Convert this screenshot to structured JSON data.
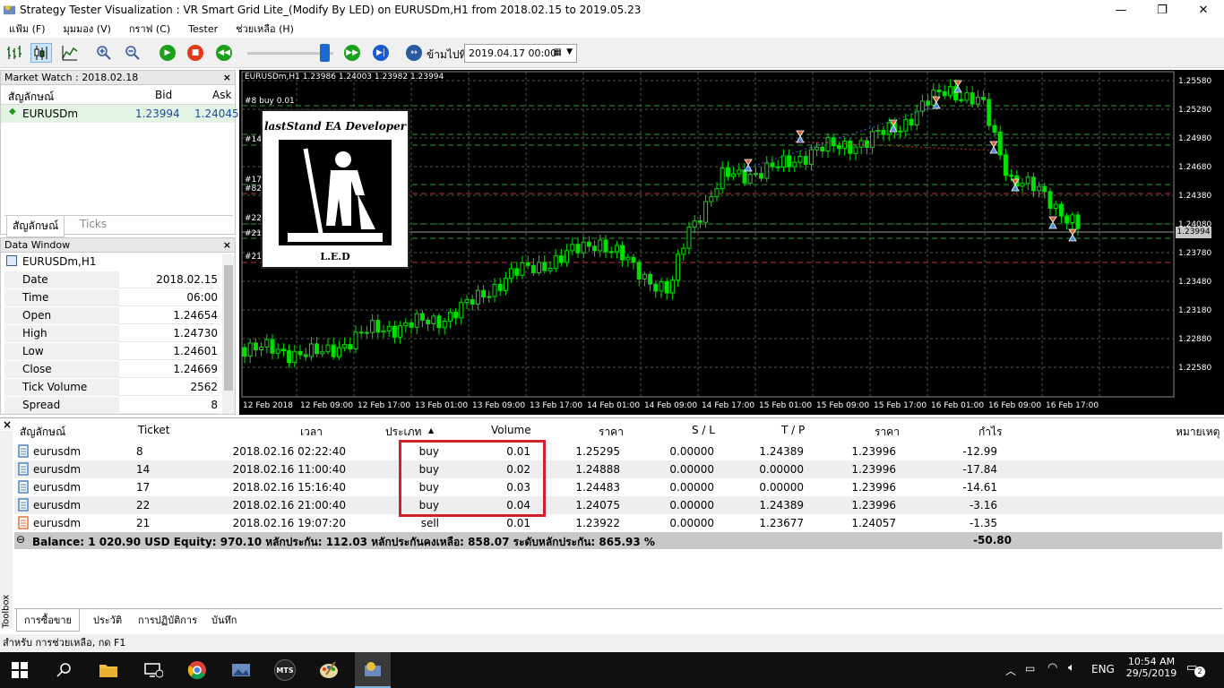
{
  "window": {
    "title": "Strategy Tester Visualization : VR Smart Grid Lite_(Modify By LED) on EURUSDm,H1 from 2018.02.15 to 2019.05.23"
  },
  "menu": [
    "แฟ้ม (F)",
    "มุมมอง (V)",
    "กราฟ (C)",
    "Tester",
    "ช่วยเหลือ (H)"
  ],
  "toolbar": {
    "goto_label": "ข้ามไปที่",
    "goto_date": "2019.04.17 00:00"
  },
  "market_watch": {
    "title": "Market Watch : 2018.02.18",
    "headers": {
      "symbol": "สัญลักษณ์",
      "bid": "Bid",
      "ask": "Ask"
    },
    "rows": [
      {
        "symbol": "EURUSDm",
        "bid": "1.23994",
        "ask": "1.24045"
      }
    ],
    "tabs": [
      "สัญลักษณ์",
      "Ticks"
    ]
  },
  "data_window": {
    "title": "Data Window",
    "symbol": "EURUSDm,H1",
    "rows": [
      {
        "key": "Date",
        "value": "2018.02.15"
      },
      {
        "key": "Time",
        "value": "06:00"
      },
      {
        "key": "Open",
        "value": "1.24654"
      },
      {
        "key": "High",
        "value": "1.24730"
      },
      {
        "key": "Low",
        "value": "1.24601"
      },
      {
        "key": "Close",
        "value": "1.24669"
      },
      {
        "key": "Tick Volume",
        "value": "2562"
      },
      {
        "key": "Spread",
        "value": "8"
      }
    ]
  },
  "chart": {
    "header": "EURUSDm,H1  1.23986 1.24003 1.23982 1.23994",
    "buy_label": "#8 buy 0.01",
    "order_tags": [
      "#14",
      "#17",
      "#82",
      "#22",
      "#21",
      "#21"
    ],
    "logo_top": "lastStand EA Developer",
    "logo_bottom": "L.E.D",
    "current_price": "1.23994",
    "price_labels": [
      "1.25580",
      "1.25280",
      "1.24980",
      "1.24680",
      "1.24380",
      "1.24080",
      "1.23780",
      "1.23480",
      "1.23180",
      "1.22880",
      "1.22580"
    ],
    "time_labels": [
      "12 Feb 2018",
      "12 Feb 09:00",
      "12 Feb 17:00",
      "13 Feb 01:00",
      "13 Feb 09:00",
      "13 Feb 17:00",
      "14 Feb 01:00",
      "14 Feb 09:00",
      "14 Feb 17:00",
      "15 Feb 01:00",
      "15 Feb 09:00",
      "15 Feb 17:00",
      "16 Feb 01:00",
      "16 Feb 09:00",
      "16 Feb 17:00"
    ]
  },
  "terminal": {
    "headers": {
      "symbol": "สัญลักษณ์",
      "ticket": "Ticket",
      "time": "เวลา",
      "type": "ประเภท",
      "volume": "Volume",
      "price": "ราคา",
      "sl": "S / L",
      "tp": "T / P",
      "price2": "ราคา",
      "profit": "กำไร",
      "comment": "หมายเหตุ"
    },
    "rows": [
      {
        "symbol": "eurusdm",
        "ticket": "8",
        "time": "2018.02.16 02:22:40",
        "type": "buy",
        "volume": "0.01",
        "price": "1.25295",
        "sl": "0.00000",
        "tp": "1.24389",
        "price2": "1.23996",
        "profit": "-12.99",
        "kind": "buy"
      },
      {
        "symbol": "eurusdm",
        "ticket": "14",
        "time": "2018.02.16 11:00:40",
        "type": "buy",
        "volume": "0.02",
        "price": "1.24888",
        "sl": "0.00000",
        "tp": "0.00000",
        "price2": "1.23996",
        "profit": "-17.84",
        "kind": "buy"
      },
      {
        "symbol": "eurusdm",
        "ticket": "17",
        "time": "2018.02.16 15:16:40",
        "type": "buy",
        "volume": "0.03",
        "price": "1.24483",
        "sl": "0.00000",
        "tp": "0.00000",
        "price2": "1.23996",
        "profit": "-14.61",
        "kind": "buy"
      },
      {
        "symbol": "eurusdm",
        "ticket": "22",
        "time": "2018.02.16 21:00:40",
        "type": "buy",
        "volume": "0.04",
        "price": "1.24075",
        "sl": "0.00000",
        "tp": "1.24389",
        "price2": "1.23996",
        "profit": "-3.16",
        "kind": "buy"
      },
      {
        "symbol": "eurusdm",
        "ticket": "21",
        "time": "2018.02.16 19:07:20",
        "type": "sell",
        "volume": "0.01",
        "price": "1.23922",
        "sl": "0.00000",
        "tp": "1.23677",
        "price2": "1.24057",
        "profit": "-1.35",
        "kind": "sell"
      }
    ],
    "balance_line": "Balance: 1 020.90 USD  Equity: 970.10  หลักประกัน: 112.03  หลักประกันคงเหลือ: 858.07  ระดับหลักประกัน: 865.93 %",
    "balance_total": "-50.80",
    "tabs": [
      "การซื้อขาย",
      "ประวัติ",
      "การปฏิบัติการ",
      "บันทึก"
    ],
    "toolbox_label": "Toolbox"
  },
  "status": {
    "text": "สำหรับ การช่วยเหลือ, กด F1"
  },
  "taskbar": {
    "lang": "ENG",
    "time": "10:54 AM",
    "date": "29/5/2019",
    "notif_count": "2",
    "mts_label": "MTS"
  },
  "colors": {
    "chart_bg": "#000000",
    "bull": "#00e000",
    "grid": "#4a5a4a",
    "highlight_box": "#d0202c",
    "balance_bg": "#c8c8c8"
  }
}
